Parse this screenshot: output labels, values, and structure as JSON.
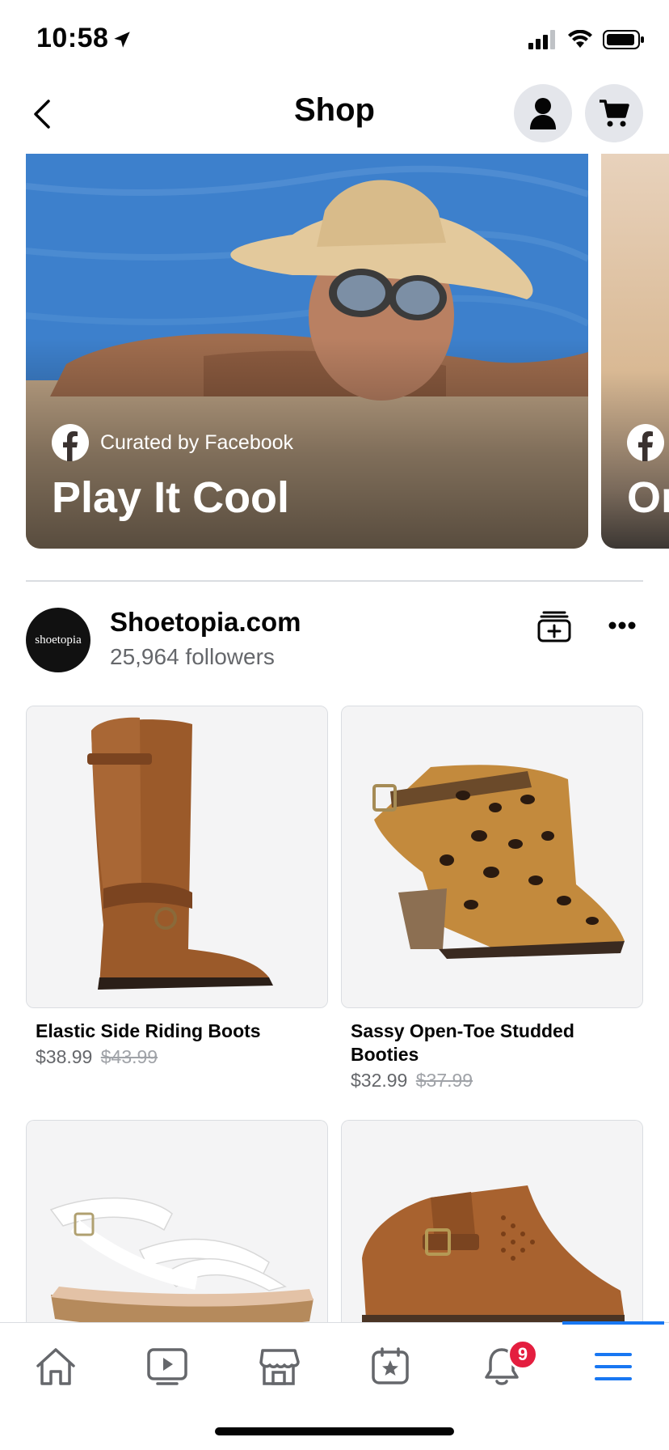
{
  "status_bar": {
    "time": "10:58"
  },
  "header": {
    "title": "Shop"
  },
  "carousel": [
    {
      "curator": "Curated by Facebook",
      "title": "Play It Cool"
    },
    {
      "curator": "",
      "title": "Or"
    }
  ],
  "shop": {
    "avatar_text": "shoetopia",
    "name": "Shoetopia.com",
    "followers": "25,964 followers"
  },
  "products": [
    {
      "name": "Elastic Side Riding Boots",
      "price": "$38.99",
      "old_price": "$43.99"
    },
    {
      "name": "Sassy Open-Toe Studded Booties",
      "price": "$32.99",
      "old_price": "$37.99"
    },
    {
      "name": "",
      "price": "",
      "old_price": ""
    },
    {
      "name": "",
      "price": "",
      "old_price": ""
    }
  ],
  "tab_bar": {
    "notifications_badge": "9",
    "tabs": [
      "home-icon",
      "watch-icon",
      "marketplace-icon",
      "pages-icon",
      "bell-icon",
      "menu-icon"
    ],
    "active_color": "#1877f2"
  },
  "colors": {
    "facebook_blue": "#1877f2",
    "badge_red": "#e41e3f",
    "secondary_text": "#65676b"
  }
}
